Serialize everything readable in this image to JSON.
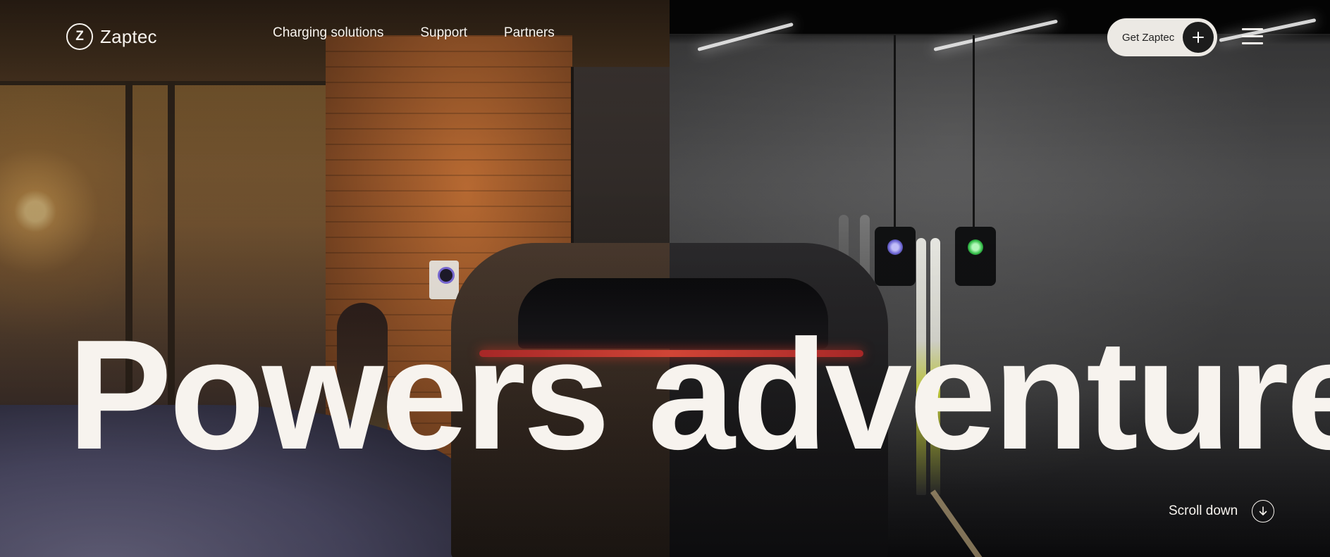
{
  "brand": {
    "name": "Zaptec",
    "logo_glyph": "Z"
  },
  "nav": {
    "items": [
      {
        "label": "Charging solutions"
      },
      {
        "label": "Support"
      },
      {
        "label": "Partners"
      }
    ]
  },
  "header": {
    "cta_label": "Get Zaptec",
    "cta_icon": "plus-icon",
    "menu_icon": "hamburger-menu-icon"
  },
  "hero": {
    "headline": "Powers adventure",
    "scroll_label": "Scroll down",
    "scroll_icon": "arrow-down-icon"
  },
  "colors": {
    "text": "#f7f3ee",
    "cta_bg": "#ece9e4",
    "cta_icon_bg": "#1c1c1c"
  }
}
